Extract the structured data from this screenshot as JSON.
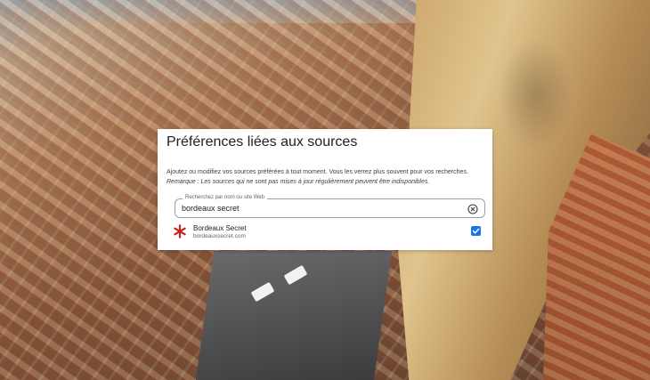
{
  "dialog": {
    "title": "Préférences liées aux sources",
    "description": "Ajoutez ou modifiez vos sources préférées à tout moment. Vous les verrez plus souvent pour vos recherches.",
    "note": "Remarque : Les sources qui ne sont pas mises à jour régulièrement peuvent être indisponibles."
  },
  "search": {
    "label": "Recherchez par nom ou site Web",
    "value": "bordeaux secret",
    "clear_icon": "clear-circle-icon"
  },
  "results": [
    {
      "name": "Bordeaux Secret",
      "url": "bordeauxsecret.com",
      "icon": "asterisk-logo-icon",
      "checked": true
    }
  ],
  "colors": {
    "accent": "#1a73e8",
    "site_logo": "#c5221f",
    "card_bg": "#ffffff"
  }
}
